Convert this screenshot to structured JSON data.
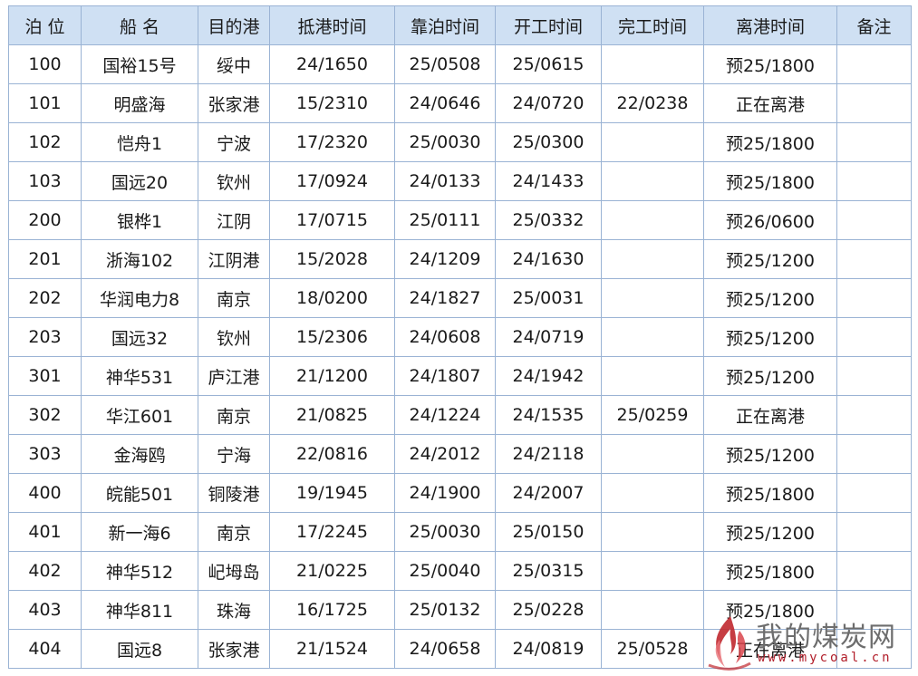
{
  "headers": [
    "泊 位",
    "船 名",
    "目的港",
    "抵港时间",
    "靠泊时间",
    "开工时间",
    "完工时间",
    "离港时间",
    "备注"
  ],
  "rows": [
    [
      "100",
      "国裕15号",
      "绥中",
      "24/1650",
      "25/0508",
      "25/0615",
      "",
      "预25/1800",
      ""
    ],
    [
      "101",
      "明盛海",
      "张家港",
      "15/2310",
      "24/0646",
      "24/0720",
      "22/0238",
      "正在离港",
      ""
    ],
    [
      "102",
      "恺舟1",
      "宁波",
      "17/2320",
      "25/0030",
      "25/0300",
      "",
      "预25/1800",
      ""
    ],
    [
      "103",
      "国远20",
      "钦州",
      "17/0924",
      "24/0133",
      "24/1433",
      "",
      "预25/1800",
      ""
    ],
    [
      "200",
      "银桦1",
      "江阴",
      "17/0715",
      "25/0111",
      "25/0332",
      "",
      "预26/0600",
      ""
    ],
    [
      "201",
      "浙海102",
      "江阴港",
      "15/2028",
      "24/1209",
      "24/1630",
      "",
      "预25/1200",
      ""
    ],
    [
      "202",
      "华润电力8",
      "南京",
      "18/0200",
      "24/1827",
      "25/0031",
      "",
      "预25/1200",
      ""
    ],
    [
      "203",
      "国远32",
      "钦州",
      "15/2306",
      "24/0608",
      "24/0719",
      "",
      "预25/1200",
      ""
    ],
    [
      "301",
      "神华531",
      "庐江港",
      "21/1200",
      "24/1807",
      "24/1942",
      "",
      "预25/1200",
      ""
    ],
    [
      "302",
      "华江601",
      "南京",
      "21/0825",
      "24/1224",
      "24/1535",
      "25/0259",
      "正在离港",
      ""
    ],
    [
      "303",
      "金海鸥",
      "宁海",
      "22/0816",
      "24/2012",
      "24/2118",
      "",
      "预25/1200",
      ""
    ],
    [
      "400",
      "皖能501",
      "铜陵港",
      "19/1945",
      "24/1900",
      "24/2007",
      "",
      "预25/1800",
      ""
    ],
    [
      "401",
      "新一海6",
      "南京",
      "17/2245",
      "25/0030",
      "25/0150",
      "",
      "预25/1200",
      ""
    ],
    [
      "402",
      "神华512",
      "屺坶岛",
      "21/0225",
      "25/0040",
      "25/0315",
      "",
      "预25/1800",
      ""
    ],
    [
      "403",
      "神华811",
      "珠海",
      "16/1725",
      "25/0132",
      "25/0228",
      "",
      "预25/1800",
      ""
    ],
    [
      "404",
      "国远8",
      "张家港",
      "21/1524",
      "24/0658",
      "24/0819",
      "25/0528",
      "正在离港",
      ""
    ]
  ],
  "watermark": {
    "name": "我的煤炭网",
    "url": "www.mycoal.cn",
    "icon": "flame-logo-icon",
    "colors": {
      "flame": "#c0282f",
      "text": "#6d6d6d",
      "url": "#b21e2a"
    }
  },
  "colors": {
    "header_bg": "#cfe0f3",
    "border": "#9ab3d4"
  }
}
